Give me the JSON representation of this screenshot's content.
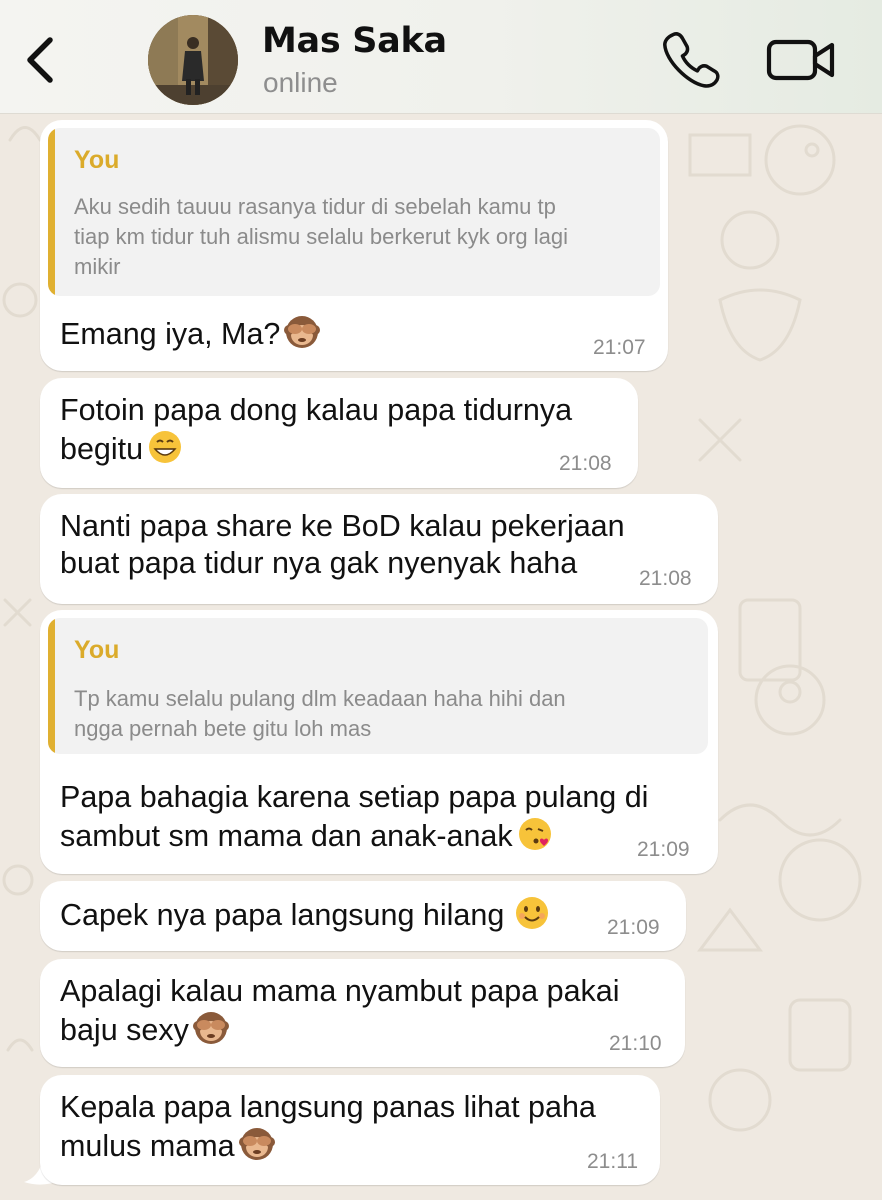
{
  "header": {
    "contact_name": "Mas Saka",
    "status": "online",
    "icons": [
      "back-chevron-icon",
      "phone-icon",
      "video-camera-icon"
    ]
  },
  "messages": [
    {
      "quote": {
        "author": "You",
        "lines": [
          "Aku sedih tauuu rasanya tidur di sebelah kamu tp",
          "tiap km tidur tuh alismu selalu berkerut kyk org lagi",
          "mikir"
        ]
      },
      "lines": [
        "Emang iya, Ma?"
      ],
      "emoji": "see-no-evil-monkey",
      "time": "21:07"
    },
    {
      "lines": [
        "Fotoin papa dong kalau papa tidurnya",
        "begitu"
      ],
      "emoji": "grinning-face",
      "time": "21:08"
    },
    {
      "lines": [
        "Nanti papa share ke BoD kalau pekerjaan",
        "buat papa tidur nya gak nyenyak haha"
      ],
      "time": "21:08"
    },
    {
      "quote": {
        "author": "You",
        "lines": [
          "Tp kamu selalu pulang dlm keadaan haha hihi dan",
          "ngga pernah bete gitu loh mas"
        ]
      },
      "lines": [
        "Papa bahagia karena setiap papa pulang di",
        "sambut sm mama dan anak-anak"
      ],
      "emoji": "face-blowing-kiss",
      "time": "21:09"
    },
    {
      "lines": [
        "Capek nya papa langsung hilang"
      ],
      "emoji": "smiling-face",
      "time": "21:09"
    },
    {
      "lines": [
        "Apalagi kalau mama nyambut papa pakai",
        "baju sexy"
      ],
      "emoji": "see-no-evil-monkey",
      "time": "21:10"
    },
    {
      "lines": [
        "Kepala papa langsung panas lihat paha",
        "mulus mama"
      ],
      "emoji": "see-no-evil-monkey",
      "time": "21:11"
    }
  ],
  "colors": {
    "chat_background": "#efe9e1",
    "bubble": "#ffffff",
    "quote_accent": "#e0b031",
    "quote_author": "#dbab2b",
    "timestamp": "#8d8d8d"
  }
}
